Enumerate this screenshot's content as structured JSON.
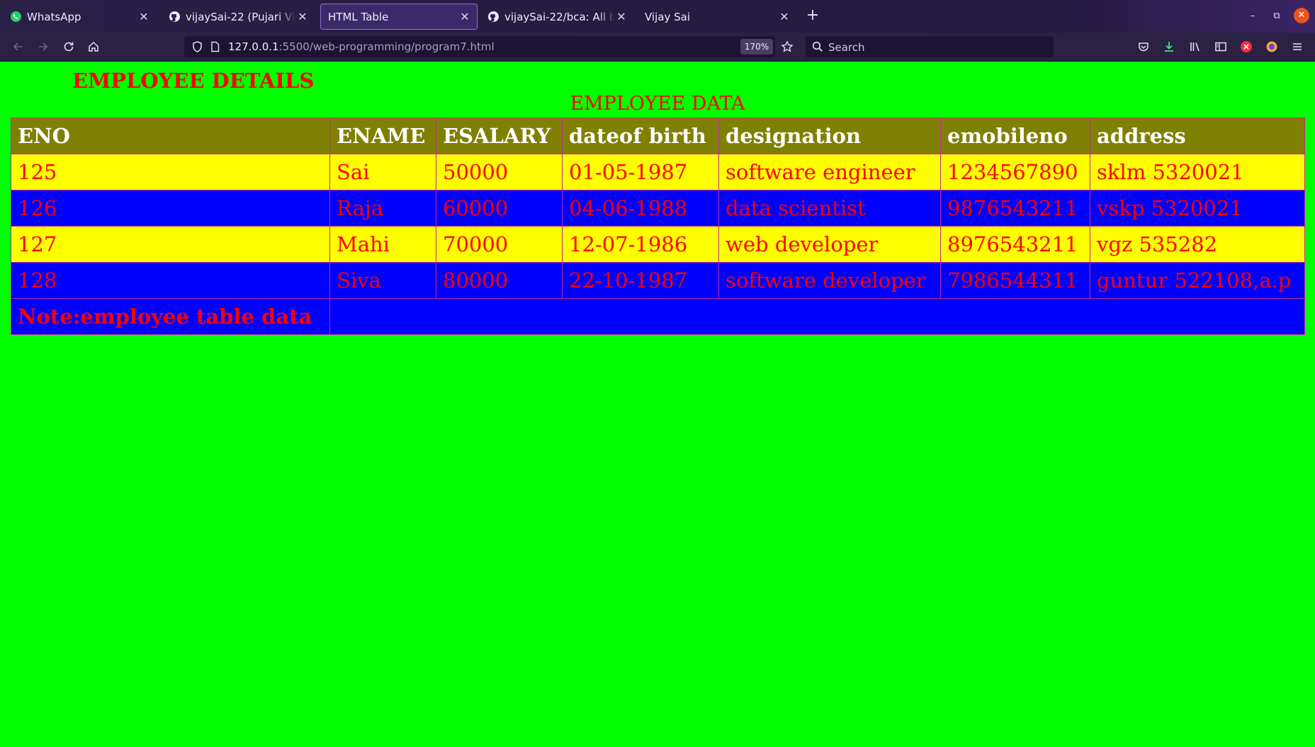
{
  "browser": {
    "tabs": [
      {
        "title": "WhatsApp",
        "icon": "whatsapp-icon",
        "active": false
      },
      {
        "title": "vijaySai-22 (Pujari Vijay Sai)",
        "icon": "github-icon",
        "active": false
      },
      {
        "title": "HTML Table",
        "icon": "",
        "active": true
      },
      {
        "title": "vijaySai-22/bca: All bca lab",
        "icon": "github-icon",
        "active": false
      },
      {
        "title": "Vijay Sai",
        "icon": "",
        "active": false
      }
    ],
    "url_host": "127.0.0.1",
    "url_path": ":5500/web-programming/program7.html",
    "zoom": "170%",
    "search_placeholder": "Search"
  },
  "page": {
    "heading": "EMPLOYEE DETAILS",
    "caption": "EMPLOYEE DATA",
    "table": {
      "headers": [
        "ENO",
        "ENAME",
        "ESALARY",
        "dateof birth",
        "designation",
        "emobileno",
        "address"
      ],
      "rows": [
        [
          "125",
          "Sai",
          "50000",
          "01-05-1987",
          "software engineer",
          "1234567890",
          "sklm 5320021"
        ],
        [
          "126",
          "Raja",
          "60000",
          "04-06-1988",
          "data scientist",
          "9876543211",
          "vskp 5320021"
        ],
        [
          "127",
          "Mahi",
          "70000",
          "12-07-1986",
          "web developer",
          "8976543211",
          "vgz 535282"
        ],
        [
          "128",
          "Siva",
          "80000",
          "22-10-1987",
          "software developer",
          "7986544311",
          "guntur 522108,a.p"
        ]
      ],
      "note": "Note:employee table data"
    }
  },
  "colors": {
    "page_bg": "#00ff00",
    "header_bg": "#808000",
    "row_odd_bg": "#ffff00",
    "row_even_bg": "#0000ff",
    "text_red": "#ff0000",
    "browser_chrome": "#2b2142"
  }
}
